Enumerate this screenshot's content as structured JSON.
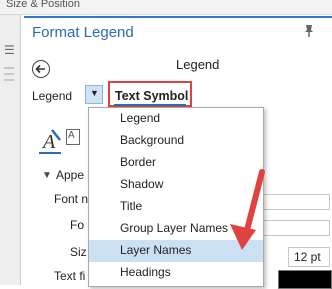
{
  "top_strip": {
    "label": "Size & Position"
  },
  "pane": {
    "title": "Format Legend",
    "subtitle": "Legend"
  },
  "tabs": {
    "legend_label": "Legend",
    "text_symbol_label": "Text Symbol"
  },
  "symbol_tabs": {
    "second_tab_text": "A"
  },
  "appearance": {
    "section_label": "Appe",
    "font_name_label": "Font n",
    "font_style_label": "Fo",
    "size_label": "Siz",
    "size_value": "12 pt",
    "text_fill_label": "Text fi"
  },
  "dropdown": {
    "items": [
      {
        "label": "Legend",
        "selected": false
      },
      {
        "label": "Background",
        "selected": false
      },
      {
        "label": "Border",
        "selected": false
      },
      {
        "label": "Shadow",
        "selected": false
      },
      {
        "label": "Title",
        "selected": false
      },
      {
        "label": "Group Layer Names",
        "selected": false
      },
      {
        "label": "Layer Names",
        "selected": true
      },
      {
        "label": "Headings",
        "selected": false
      }
    ]
  },
  "colors": {
    "accent": "#2b6cb7",
    "highlight_box": "#e0423f",
    "annotation_arrow": "#e0423f",
    "selected_item": "#cce0f4",
    "text_fill": "#000000"
  }
}
